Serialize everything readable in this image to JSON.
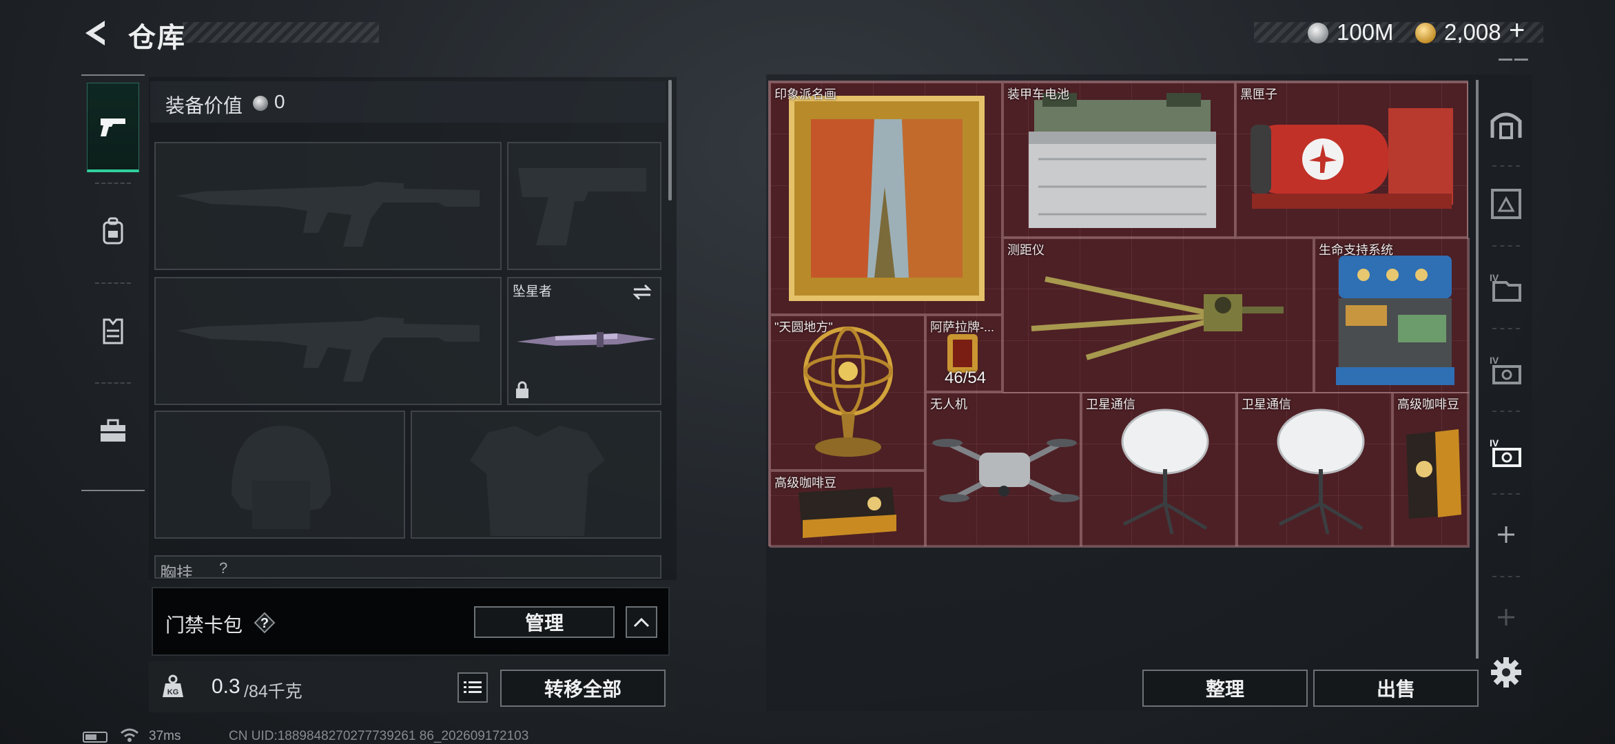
{
  "header": {
    "title": "仓库",
    "silver_amount": "100M",
    "gold_amount": "2,008",
    "add_symbol": "+",
    "tiny_text": "▬▬ ▬▬"
  },
  "left_tabs": [
    "pistol-icon",
    "backpack-icon",
    "vest-icon",
    "toolbox-icon"
  ],
  "equipment": {
    "value_label": "装备价值",
    "value": "0",
    "melee_slot_label": "坠星者",
    "chest_rig_label": "胸挂",
    "chest_rig_help": "?"
  },
  "card_bag": {
    "label": "门禁卡包",
    "help": "?",
    "manage_button": "管理"
  },
  "weight": {
    "current": "0.3",
    "max": "/84千克"
  },
  "transfer_all_button": "转移全部",
  "status_bar": {
    "ping": "37ms",
    "uid": "CN UID:1889848270277739261 86_202609172103"
  },
  "storage_items": [
    {
      "name": "印象派名画"
    },
    {
      "name": "装甲车电池"
    },
    {
      "name": "黑匣子"
    },
    {
      "name": "测距仪"
    },
    {
      "name": "生命支持系统"
    },
    {
      "name": "\"天圆地方\""
    },
    {
      "name": "阿萨拉牌-...",
      "count": "46/54"
    },
    {
      "name": "无人机"
    },
    {
      "name": "卫星通信"
    },
    {
      "name": "卫星通信"
    },
    {
      "name": "高级咖啡豆"
    },
    {
      "name": "高级咖啡豆"
    }
  ],
  "storage_buttons": {
    "sort": "整理",
    "sell": "出售"
  },
  "right_tabs": [
    "vault-icon",
    "warehouse-2-icon",
    "warehouse-3-icon",
    "warehouse-4-icon",
    "warehouse-5-icon",
    "add-tab-icon",
    "add-tab-disabled-icon"
  ],
  "colors": {
    "accent_green": "#2fd19d",
    "grid_background": "#4a1f24",
    "panel_border": "#7f5e62"
  }
}
